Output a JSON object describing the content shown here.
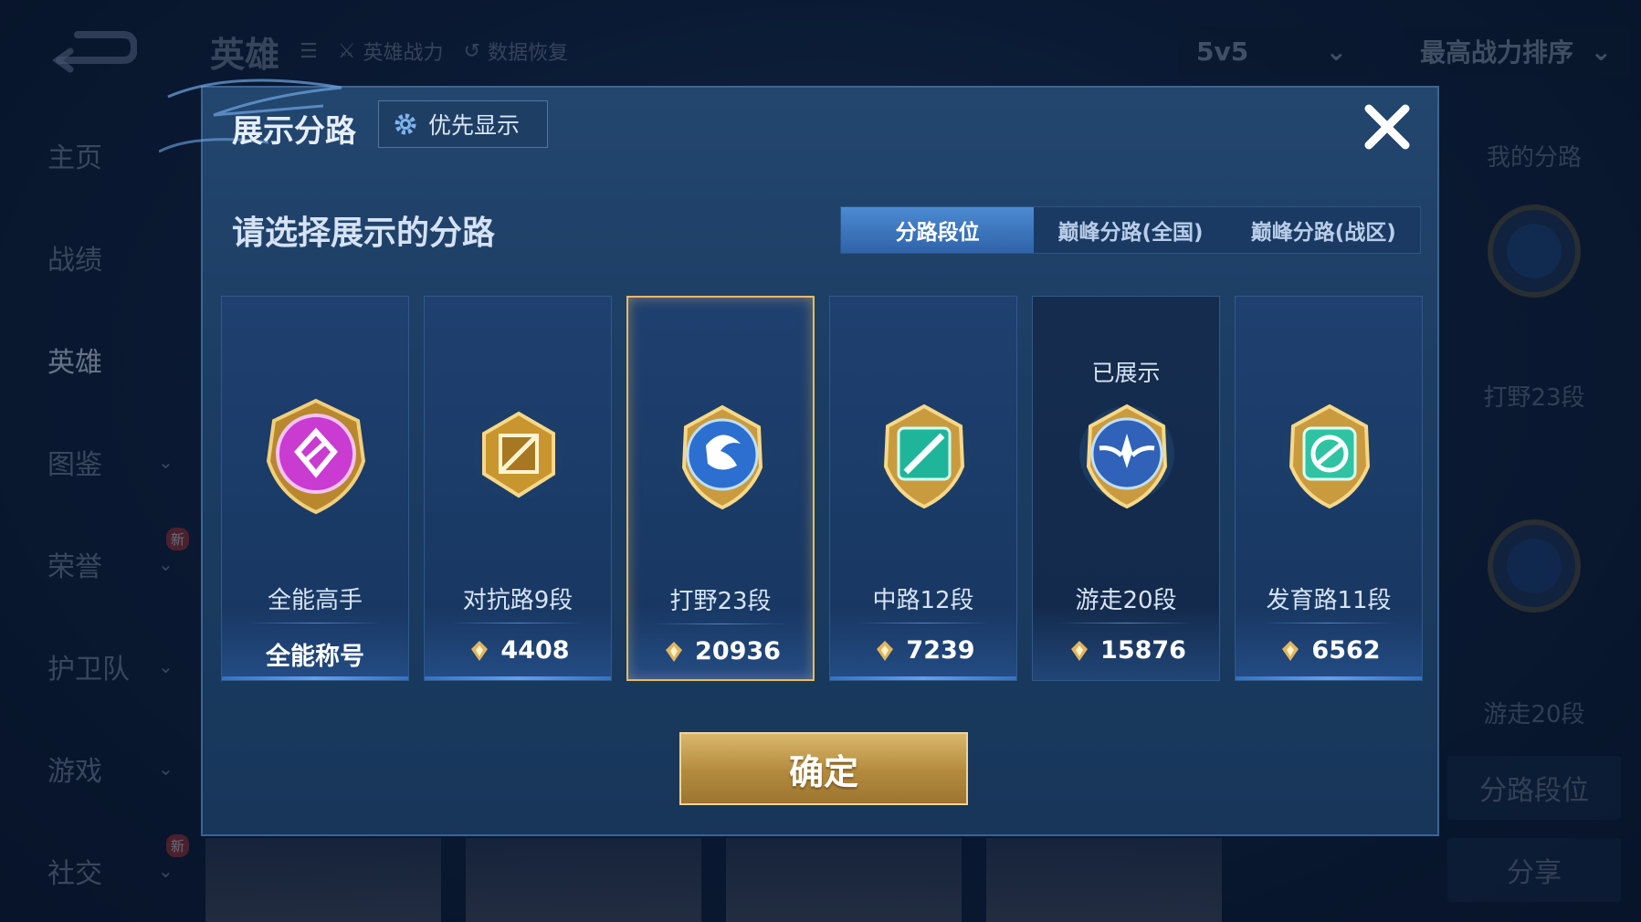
{
  "background": {
    "topbar": {
      "title": "英雄",
      "hero_power": "英雄战力",
      "data_recover": "数据恢复",
      "mode_dropdown": "5v5",
      "sort_dropdown": "最高战力排序"
    },
    "sidebar": {
      "items": [
        {
          "label": "主页"
        },
        {
          "label": "战绩"
        },
        {
          "label": "英雄"
        },
        {
          "label": "图鉴"
        },
        {
          "label": "荣誉",
          "badge": "新"
        },
        {
          "label": "护卫队"
        },
        {
          "label": "游戏"
        },
        {
          "label": "社交",
          "badge": "新"
        }
      ]
    },
    "right_panel": {
      "title": "我的分路",
      "lane1": "打野23段",
      "lane2": "游走20段",
      "lane_button": "分路段位",
      "share_button": "分享"
    }
  },
  "modal": {
    "title": "展示分路",
    "priority_button": "优先显示",
    "subtitle": "请选择展示的分路",
    "tabs": [
      {
        "label": "分路段位",
        "active": true
      },
      {
        "label": "巅峰分路(全国)",
        "active": false
      },
      {
        "label": "巅峰分路(战区)",
        "active": false
      }
    ],
    "cards": [
      {
        "name": "全能高手",
        "value": "全能称号",
        "has_icon": false,
        "color": "#c93bd1"
      },
      {
        "name": "对抗路9段",
        "value": "4408",
        "has_icon": true,
        "color": "#c9952f"
      },
      {
        "name": "打野23段",
        "value": "20936",
        "has_icon": true,
        "color": "#2d6fd0",
        "selected": true
      },
      {
        "name": "中路12段",
        "value": "7239",
        "has_icon": true,
        "color": "#1fb59a"
      },
      {
        "name": "游走20段",
        "value": "15876",
        "has_icon": true,
        "color": "#2f62b8",
        "shown_label": "已展示"
      },
      {
        "name": "发育路11段",
        "value": "6562",
        "has_icon": true,
        "color": "#2fc3a4"
      }
    ],
    "confirm_button": "确定"
  }
}
